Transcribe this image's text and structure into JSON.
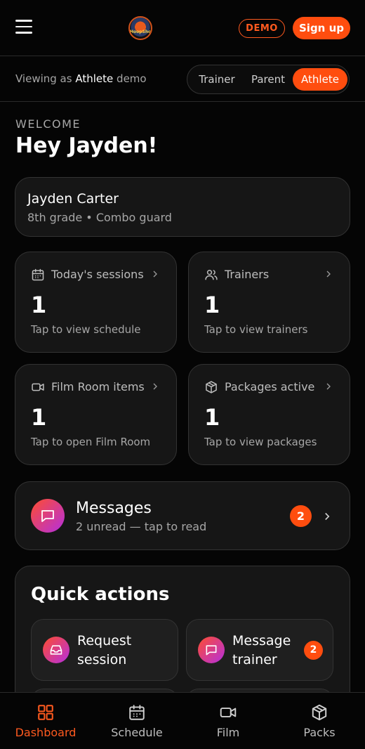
{
  "header": {
    "demo_label": "DEMO",
    "signup_label": "Sign up",
    "logo_text": "HoopShop"
  },
  "view_switcher": {
    "prefix": "Viewing as",
    "role": "Athlete",
    "suffix": "demo",
    "options": [
      "Trainer",
      "Parent",
      "Athlete"
    ],
    "selected": "Athlete"
  },
  "welcome": {
    "eyebrow": "WELCOME",
    "greeting": "Hey Jayden!"
  },
  "profile": {
    "name": "Jayden Carter",
    "meta": "8th grade • Combo guard"
  },
  "stats": [
    {
      "label": "Today's sessions",
      "value": "1",
      "hint": "Tap to view schedule",
      "icon": "calendar-icon"
    },
    {
      "label": "Trainers",
      "value": "1",
      "hint": "Tap to view trainers",
      "icon": "users-icon"
    },
    {
      "label": "Film Room items",
      "value": "1",
      "hint": "Tap to open Film Room",
      "icon": "video-icon"
    },
    {
      "label": "Packages active",
      "value": "1",
      "hint": "Tap to view packages",
      "icon": "package-icon"
    }
  ],
  "messages": {
    "title": "Messages",
    "subtitle": "2 unread — tap to read",
    "badge": "2"
  },
  "quick_actions": {
    "title": "Quick actions",
    "items": [
      {
        "label": "Request session",
        "icon": "inbox-icon",
        "badge": ""
      },
      {
        "label": "Message trainer",
        "icon": "message-icon",
        "badge": "2"
      }
    ]
  },
  "nav": {
    "items": [
      {
        "label": "Dashboard",
        "icon": "dashboard-icon"
      },
      {
        "label": "Schedule",
        "icon": "calendar-icon"
      },
      {
        "label": "Film",
        "icon": "video-icon"
      },
      {
        "label": "Packs",
        "icon": "package-icon"
      }
    ],
    "active": "Dashboard"
  },
  "colors": {
    "accent": "#ff4d0f",
    "background": "#050505",
    "card": "#161616"
  }
}
